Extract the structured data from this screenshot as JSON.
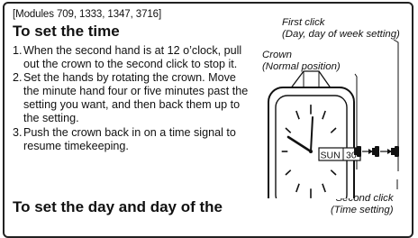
{
  "modules_line": "[Modules 709, 1333, 1347, 3716]",
  "section_title": "To set the time",
  "next_section_title": "To set the day and day of the",
  "steps": [
    {
      "num": "1.",
      "text": "When the second hand is at 12 o’clock, pull out the crown to the second click to stop it."
    },
    {
      "num": "2.",
      "text": "Set the hands by rotating the crown. Move the minute hand four or five minutes past the setting you want, and then back them up to the setting."
    },
    {
      "num": "3.",
      "text": "Push the crown back in on a time signal to resume timekeeping."
    }
  ],
  "diagram": {
    "first_click_line1": "First click",
    "first_click_line2": "(Day, day of week setting)",
    "crown_line1": "Crown",
    "crown_line2": "(Normal position)",
    "second_click_line1": "Second click",
    "second_click_line2": "(Time setting)",
    "day_of_week": "SUN",
    "date": "30"
  }
}
